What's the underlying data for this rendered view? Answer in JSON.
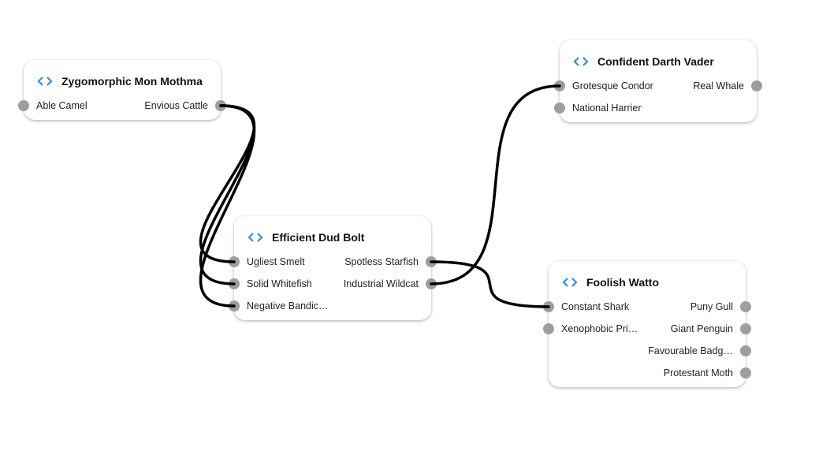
{
  "colors": {
    "icon": "#2f8fe6",
    "port": "#9e9e9e",
    "wire": "#000000"
  },
  "nodes": [
    {
      "id": "n1",
      "title": "Zygomorphic Mon Mothma",
      "icon": "code-icon",
      "inputs": [
        "Able Camel"
      ],
      "outputs": [
        "Envious Cattle"
      ]
    },
    {
      "id": "n2",
      "title": "Efficient Dud Bolt",
      "icon": "code-icon",
      "inputs": [
        "Ugliest Smelt",
        "Solid Whitefish",
        "Negative Bandic…"
      ],
      "outputs": [
        "Spotless Starfish",
        "Industrial Wildcat"
      ]
    },
    {
      "id": "n3",
      "title": "Confident Darth Vader",
      "icon": "code-icon",
      "inputs": [
        "Grotesque Condor",
        "National Harrier"
      ],
      "outputs": [
        "Real Whale"
      ]
    },
    {
      "id": "n4",
      "title": "Foolish Watto",
      "icon": "code-icon",
      "inputs": [
        "Constant Shark",
        "Xenophobic Pri…"
      ],
      "outputs": [
        "Puny Gull",
        "Giant Penguin",
        "Favourable Badg…",
        "Protestant Moth"
      ]
    }
  ],
  "connections": [
    {
      "from": "Envious Cattle",
      "to": "Ugliest Smelt"
    },
    {
      "from": "Envious Cattle",
      "to": "Solid Whitefish"
    },
    {
      "from": "Envious Cattle",
      "to": "Negative Bandic…"
    },
    {
      "from": "Spotless Starfish",
      "to": "Constant Shark"
    },
    {
      "from": "Industrial Wildcat",
      "to": "Grotesque Condor"
    }
  ]
}
